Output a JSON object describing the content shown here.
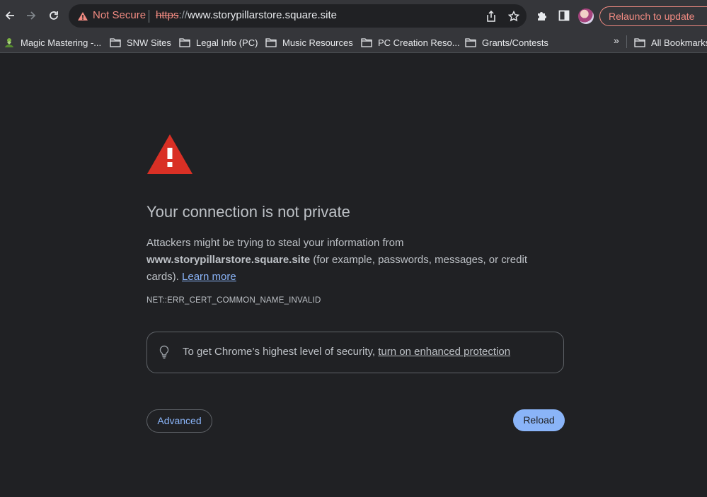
{
  "browser": {
    "nav": {
      "back_icon": "arrow-left-icon",
      "forward_icon": "arrow-right-icon",
      "reload_icon": "reload-icon"
    },
    "omnibox": {
      "security_label": "Not Secure",
      "url_scheme": "https",
      "url_separator": "://",
      "url_host": "www.storypillarstore.square.site"
    },
    "relaunch_label": "Relaunch to update"
  },
  "bookmarks": {
    "items": [
      {
        "label": "Magic Mastering -...",
        "icon": "app-favicon"
      },
      {
        "label": "SNW Sites",
        "icon": "folder-icon"
      },
      {
        "label": "Legal Info (PC)",
        "icon": "folder-icon"
      },
      {
        "label": "Music Resources",
        "icon": "folder-icon"
      },
      {
        "label": "PC Creation Reso...",
        "icon": "folder-icon"
      },
      {
        "label": "Grants/Contests",
        "icon": "folder-icon"
      }
    ],
    "overflow_label": "»",
    "all_bookmarks_label": "All Bookmarks"
  },
  "interstitial": {
    "heading": "Your connection is not private",
    "body_prefix": "Attackers might be trying to steal your information from",
    "body_host": "www.storypillarstore.square.site",
    "body_suffix": " (for example, passwords, messages, or credit cards). ",
    "learn_more": "Learn more",
    "error_code": "NET::ERR_CERT_COMMON_NAME_INVALID",
    "enhanced_text": "To get Chrome’s highest level of security, ",
    "enhanced_link": "turn on enhanced protection",
    "advanced_label": "Advanced",
    "reload_label": "Reload"
  },
  "colors": {
    "background": "#202124",
    "toolbar": "#35363a",
    "danger": "#f28b82",
    "warning_triangle": "#d93025",
    "link": "#8ab4f8",
    "text": "#bdc1c6"
  }
}
